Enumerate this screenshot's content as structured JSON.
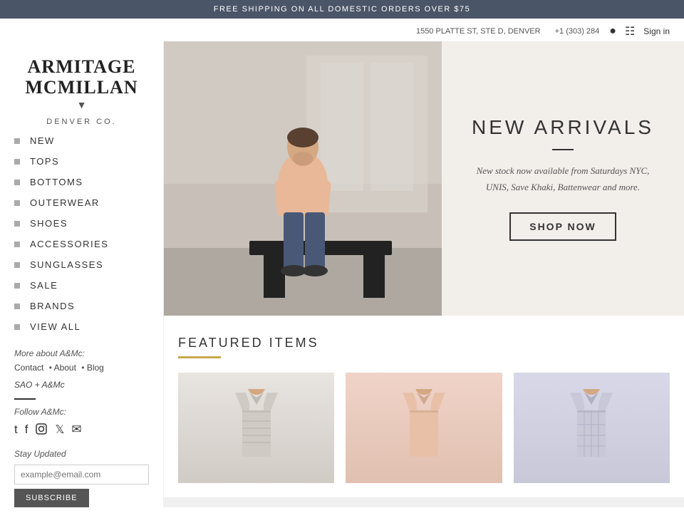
{
  "banner": {
    "text": "FREE SHIPPING ON ALL DOMESTIC ORDERS OVER $75"
  },
  "header": {
    "address": "1550 PLATTE ST, STE D, DENVER",
    "phone": "+1 (303) 284",
    "search_label": "search",
    "cart_label": "cart",
    "signin_label": "Sign in"
  },
  "logo": {
    "line1": "ARMITAGE",
    "line2": "McMILLAN",
    "sub": "DENVER CO.",
    "chevron": "▼"
  },
  "nav": {
    "items": [
      {
        "label": "NEW"
      },
      {
        "label": "TOPS"
      },
      {
        "label": "BOTTOMS"
      },
      {
        "label": "OUTERWEAR"
      },
      {
        "label": "SHOES"
      },
      {
        "label": "ACCESSORIES"
      },
      {
        "label": "SUNGLASSES"
      },
      {
        "label": "SALE"
      },
      {
        "label": "BRANDS"
      },
      {
        "label": "VIEW ALL"
      }
    ]
  },
  "sidebar_footer": {
    "about_label": "More about A&Mc:",
    "contact": "Contact",
    "about": "About",
    "blog": "Blog",
    "sao": "SAO + A&Mc",
    "follow_label": "Follow A&Mc:",
    "stay_updated": "Stay Updated",
    "email_placeholder": "example@email.com",
    "subscribe_btn": "SUBSCRIBE"
  },
  "hero": {
    "title": "NEW ARRIVALS",
    "description": "New stock now available from Saturdays NYC, UNIS, Save Khaki, Battenwear and more.",
    "shop_now": "SHOP NOW"
  },
  "featured": {
    "title": "FEATURED ITEMS"
  }
}
